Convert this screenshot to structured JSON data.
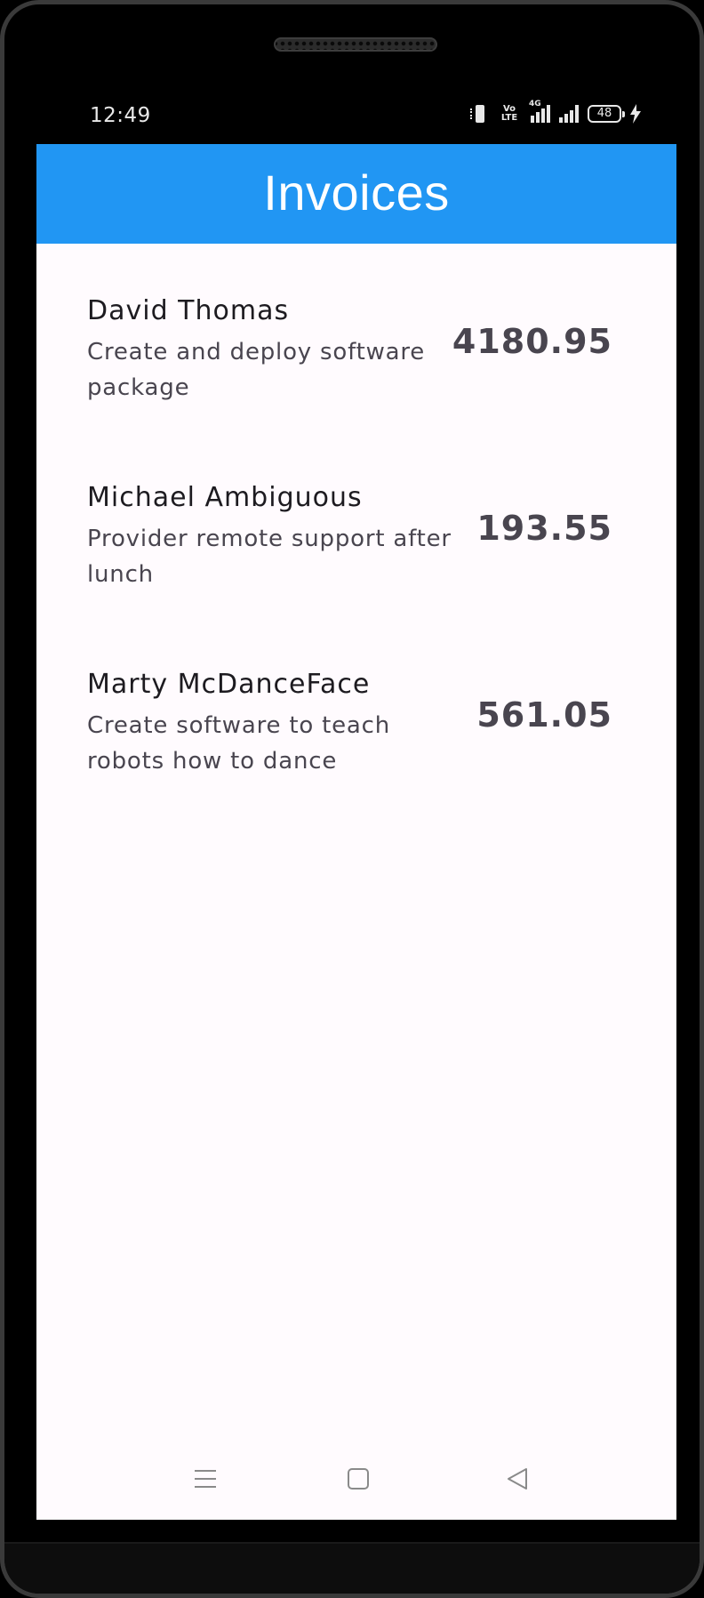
{
  "status_bar": {
    "time": "12:49",
    "network_label": "4G",
    "volte_label": "Vo LTE",
    "battery_level": "48"
  },
  "app_bar": {
    "title": "Invoices",
    "color": "#2196f3"
  },
  "invoices": [
    {
      "name": "David Thomas",
      "description": "Create and deploy software package",
      "amount": "4180.95"
    },
    {
      "name": "Michael Ambiguous",
      "description": "Provider remote support after lunch",
      "amount": "193.55"
    },
    {
      "name": "Marty McDanceFace",
      "description": "Create software to teach robots how to dance",
      "amount": "561.05"
    }
  ],
  "nav_bar": {
    "icons": [
      "menu-icon",
      "home-icon",
      "back-icon"
    ]
  }
}
